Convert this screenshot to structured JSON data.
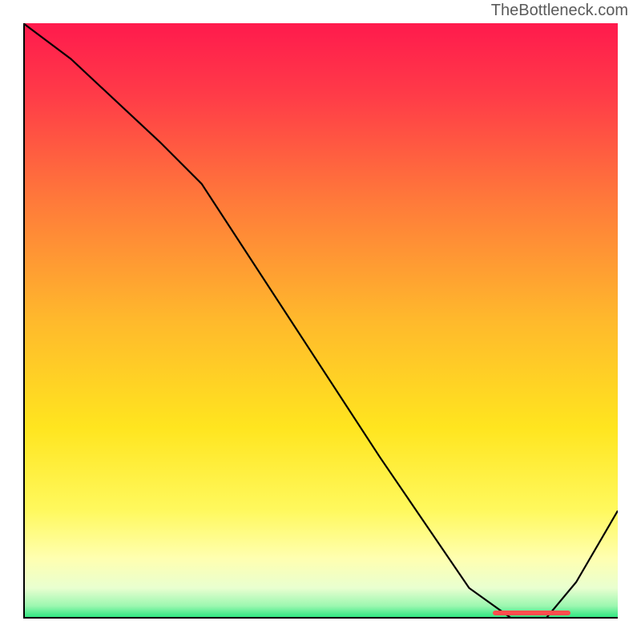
{
  "attribution": "TheBottleneck.com",
  "colors": {
    "gradient_stops": [
      {
        "offset": "0%",
        "color": "#ff1a4d"
      },
      {
        "offset": "12%",
        "color": "#ff3b48"
      },
      {
        "offset": "30%",
        "color": "#ff7a3a"
      },
      {
        "offset": "50%",
        "color": "#ffb92c"
      },
      {
        "offset": "68%",
        "color": "#ffe51f"
      },
      {
        "offset": "82%",
        "color": "#fff95e"
      },
      {
        "offset": "90%",
        "color": "#ffffb0"
      },
      {
        "offset": "95%",
        "color": "#e9ffd0"
      },
      {
        "offset": "98%",
        "color": "#9cf7b0"
      },
      {
        "offset": "100%",
        "color": "#28e67e"
      }
    ],
    "curve_stroke": "#000000",
    "marker_color": "#ff4d4d",
    "axis_color": "#000000"
  },
  "chart_data": {
    "type": "line",
    "title": "",
    "xlabel": "",
    "ylabel": "",
    "xlim": [
      0,
      100
    ],
    "ylim": [
      0,
      100
    ],
    "series": [
      {
        "name": "bottleneck_curve",
        "x": [
          0,
          8,
          23,
          30,
          45,
          60,
          75,
          82,
          88,
          93,
          100
        ],
        "y": [
          100,
          94,
          80,
          73,
          50,
          27,
          5,
          0,
          0,
          6,
          18
        ]
      }
    ],
    "optimal_range_x": [
      79,
      92
    ],
    "optimal_marker_y": 0.8
  }
}
